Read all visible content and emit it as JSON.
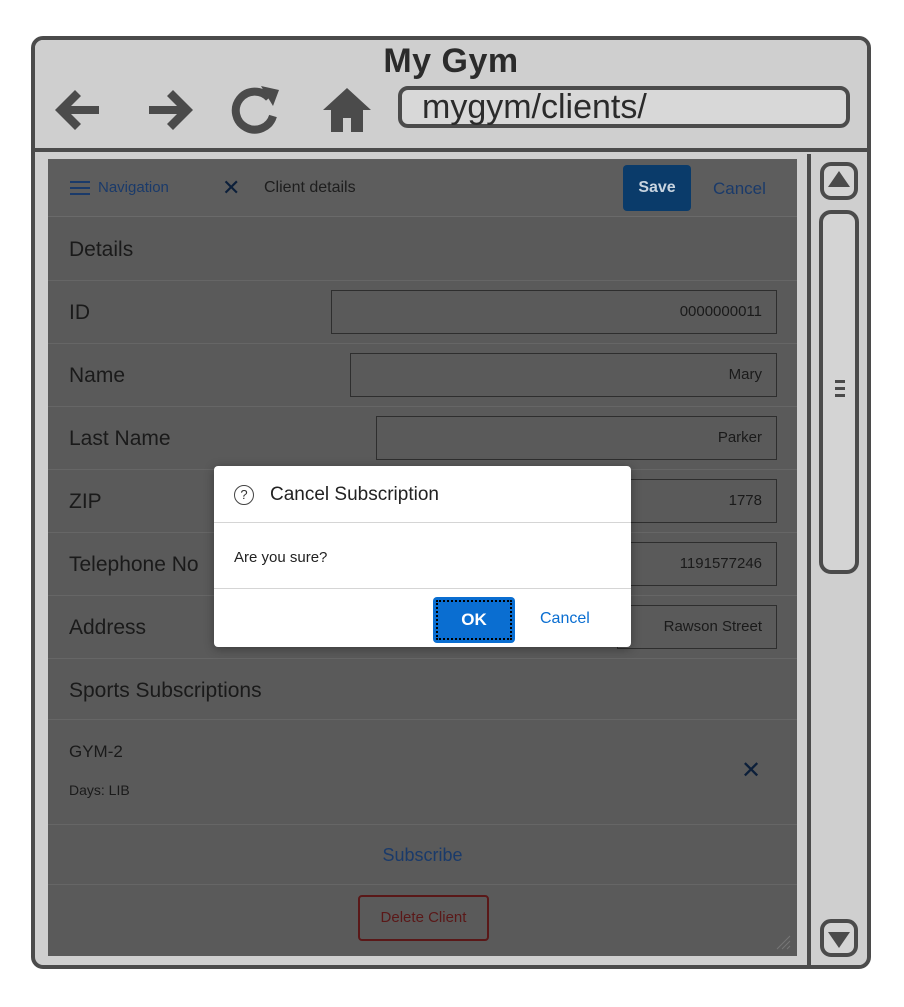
{
  "window": {
    "title": "My Gym",
    "url": "mygym/clients/"
  },
  "header": {
    "navigation_label": "Navigation",
    "title": "Client details",
    "save_label": "Save",
    "cancel_label": "Cancel"
  },
  "details": {
    "section_title": "Details",
    "fields": [
      {
        "label": "ID",
        "value": "0000000011"
      },
      {
        "label": "Name",
        "value": "Mary"
      },
      {
        "label": "Last Name",
        "value": "Parker"
      },
      {
        "label": "ZIP",
        "value": "1778"
      },
      {
        "label": "Telephone No",
        "value": "1191577246"
      },
      {
        "label": "Address",
        "value": "Rawson Street"
      }
    ]
  },
  "subscriptions": {
    "section_title": "Sports Subscriptions",
    "items": [
      {
        "name": "GYM-2",
        "days": "Days: LIB"
      }
    ],
    "subscribe_label": "Subscribe"
  },
  "delete_label": "Delete Client",
  "dialog": {
    "title": "Cancel Subscription",
    "message": "Are you sure?",
    "ok_label": "OK",
    "cancel_label": "Cancel"
  },
  "colors": {
    "primary": "#0a6ed1",
    "overlay_dim": "#5a5a5a",
    "chrome": "#cfcfcf",
    "border": "#4b4b4b",
    "delete": "#5a1818"
  }
}
